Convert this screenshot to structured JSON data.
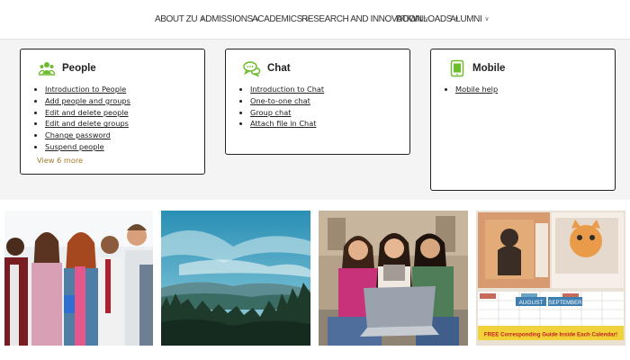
{
  "nav": {
    "items": [
      {
        "label": "ABOUT ZU"
      },
      {
        "label": "ADMISSIONS"
      },
      {
        "label": "ACADEMICS"
      },
      {
        "label": "RESEARCH AND INNOVATION"
      },
      {
        "label": "DOWNLOADS"
      },
      {
        "label": "ALUMNI"
      }
    ]
  },
  "cards": {
    "people": {
      "title": "People",
      "icon": "people-icon",
      "links": [
        "Introduction to People",
        "Add people and groups",
        "Edit and delete people",
        "Edit and delete groups",
        "Change password",
        "Suspend people"
      ],
      "more": "View 6 more"
    },
    "chat": {
      "title": "Chat",
      "icon": "chat-bubbles-icon",
      "links": [
        "Introduction to Chat",
        "One-to-one chat",
        "Group chat",
        "Attach file in Chat"
      ]
    },
    "mobile": {
      "title": "Mobile",
      "icon": "mobile-device-icon",
      "links": [
        "Mobile help"
      ]
    }
  },
  "photos": {
    "calendar_banner": "FREE Corresponding Guide Inside Each Calendar!",
    "calendar_tabs": [
      "AUGUST",
      "SEPTEMBER"
    ]
  },
  "colors": {
    "accent_green": "#6dbb2e",
    "view_more": "#a07a2a",
    "card_border": "#222222",
    "background": "#f4f4f4"
  }
}
